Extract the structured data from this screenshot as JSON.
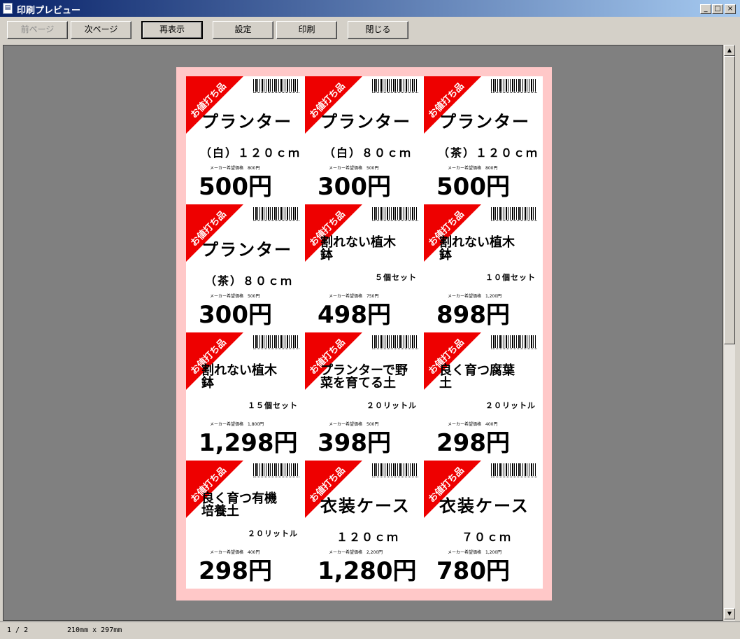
{
  "window": {
    "title": "印刷プレビュー",
    "minimize": "_",
    "maximize": "□",
    "close": "×"
  },
  "toolbar": {
    "prev_page": "前ページ",
    "next_page": "次ページ",
    "refresh": "再表示",
    "settings": "設定",
    "print": "印刷",
    "close": "閉じる"
  },
  "scrollbar": {
    "up": "▲",
    "down": "▼"
  },
  "status": {
    "page": "1 / 2",
    "paper_size": "210mm x 297mm"
  },
  "colors": {
    "badge": "#e00000",
    "border": "#ffc8c8",
    "viewport": "#808080"
  },
  "labels": [
    {
      "badge": "お値打ち品",
      "name": "プランター",
      "sub": "（白）１２０ｃｍ",
      "ref": "メーカー希望価格　800円",
      "price": "500円"
    },
    {
      "badge": "お値打ち品",
      "name": "プランター",
      "sub": "（白）８０ｃｍ",
      "ref": "メーカー希望価格　500円",
      "price": "300円"
    },
    {
      "badge": "お値打ち品",
      "name": "プランター",
      "sub": "（茶）１２０ｃｍ",
      "ref": "メーカー希望価格　800円",
      "price": "500円"
    },
    {
      "badge": "お値打ち品",
      "name": "プランター",
      "sub": "（茶）８０ｃｍ",
      "ref": "メーカー希望価格　500円",
      "price": "300円"
    },
    {
      "badge": "お値打ち品",
      "name": "割れない植木鉢",
      "sub": "５個セット",
      "ref": "メーカー希望価格　750円",
      "price": "498円"
    },
    {
      "badge": "お値打ち品",
      "name": "割れない植木鉢",
      "sub": "１０個セット",
      "ref": "メーカー希望価格　1,200円",
      "price": "898円"
    },
    {
      "badge": "お値打ち品",
      "name": "割れない植木鉢",
      "sub": "１５個セット",
      "ref": "メーカー希望価格　1,800円",
      "price": "1,298円"
    },
    {
      "badge": "お値打ち品",
      "name": "プランターで野菜を育てる土",
      "sub": "２０リットル",
      "ref": "メーカー希望価格　500円",
      "price": "398円"
    },
    {
      "badge": "お値打ち品",
      "name": "良く育つ腐葉土",
      "sub": "２０リットル",
      "ref": "メーカー希望価格　400円",
      "price": "298円"
    },
    {
      "badge": "お値打ち品",
      "name": "良く育つ有機培養土",
      "sub": "２０リットル",
      "ref": "メーカー希望価格　400円",
      "price": "298円"
    },
    {
      "badge": "お値打ち品",
      "name": "衣装ケース",
      "sub": "１２０ｃｍ",
      "ref": "メーカー希望価格　2,200円",
      "price": "1,280円"
    },
    {
      "badge": "お値打ち品",
      "name": "衣装ケース",
      "sub": "７０ｃｍ",
      "ref": "メーカー希望価格　1,200円",
      "price": "780円"
    }
  ]
}
